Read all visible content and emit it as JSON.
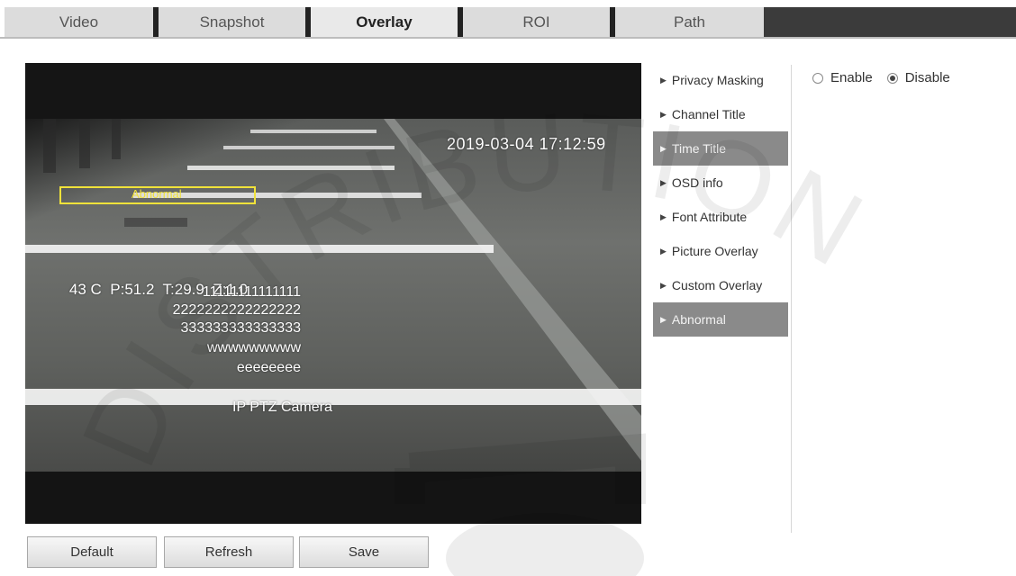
{
  "tabs": [
    {
      "label": "Video",
      "active": false
    },
    {
      "label": "Snapshot",
      "active": false
    },
    {
      "label": "Overlay",
      "active": true
    },
    {
      "label": "ROI",
      "active": false
    },
    {
      "label": "Path",
      "active": false
    }
  ],
  "preview": {
    "time_title": "2019-03-04 17:12:59",
    "abnormal_label": "Abnormal",
    "ptz_info": "43 C  P:51.2  T:29.9  Z:1.0",
    "custom_lines": [
      "11111111111111",
      "2222222222222222",
      "333333333333333",
      "wwwwwwwww",
      "eeeeeeee"
    ],
    "channel_title": "IP PTZ Camera"
  },
  "menu": [
    {
      "label": "Privacy Masking",
      "active": false
    },
    {
      "label": "Channel Title",
      "active": false
    },
    {
      "label": "Time Title",
      "active": true
    },
    {
      "label": "OSD info",
      "active": false
    },
    {
      "label": "Font Attribute",
      "active": false
    },
    {
      "label": "Picture Overlay",
      "active": false
    },
    {
      "label": "Custom Overlay",
      "active": false
    },
    {
      "label": "Abnormal",
      "active": true
    }
  ],
  "enable_options": {
    "enable_label": "Enable",
    "disable_label": "Disable",
    "selected": "Disable"
  },
  "buttons": {
    "default_label": "Default",
    "refresh_label": "Refresh",
    "save_label": "Save"
  },
  "watermark_text": "DISTRIBUTION",
  "colors": {
    "active_menu": "#8a8a8a",
    "abnormal_box": "#f0e23a"
  }
}
